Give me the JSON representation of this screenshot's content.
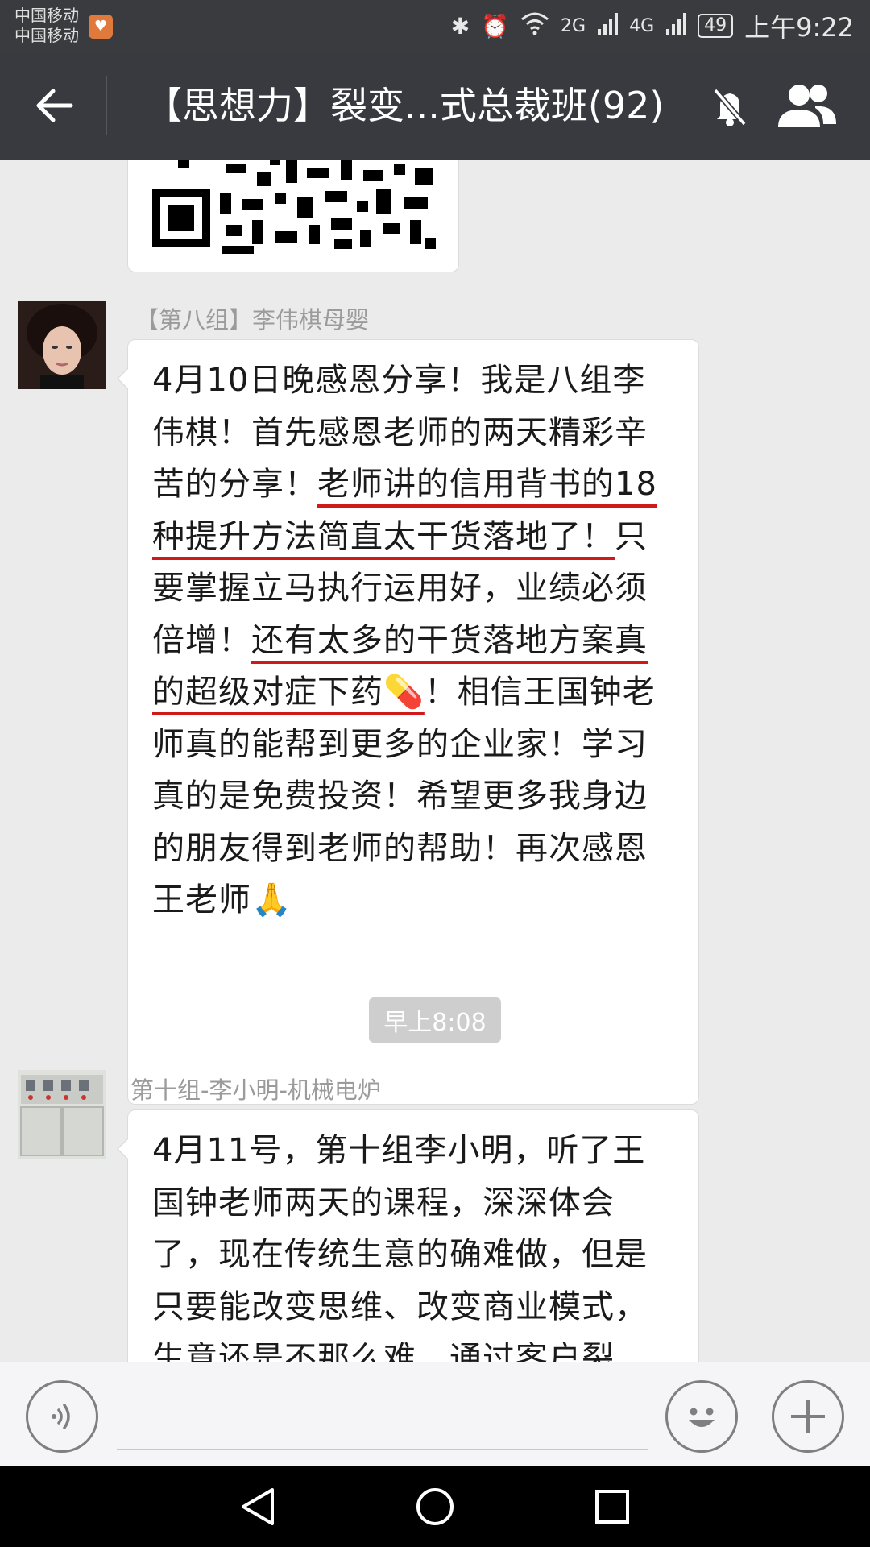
{
  "status_bar": {
    "carrier_1": "中国移动",
    "carrier_2": "中国移动",
    "network_1": "2G",
    "network_2": "4G",
    "battery": "49",
    "time": "上午9:22"
  },
  "header": {
    "title": "【思想力】裂变...式总裁班(92)",
    "icons": [
      "back-arrow-icon",
      "mute-bell-icon",
      "group-members-icon"
    ]
  },
  "messages": [
    {
      "sender": "【第八组】李伟棋母婴",
      "segments": [
        {
          "text": "4月10日晚感恩分享！我是八组李伟棋！首先感恩老师的两天精彩辛苦的分享！",
          "hl": false
        },
        {
          "text": "老师讲的信用背书的18种提升方法简直太干货落地了！",
          "hl": true
        },
        {
          "text": "只要掌握立马执行运用好，业绩必须倍增！",
          "hl": false
        },
        {
          "text": "还有太多的干货落地方案真的超级对症下药💊",
          "hl": true
        },
        {
          "text": "！相信王国钟老师真的能帮到更多的企业家！学习真的是免费投资！希望更多我身边的朋友得到老师的帮助！再次感恩王老师🙏",
          "hl": false
        }
      ]
    },
    {
      "sender": "第十组-李小明-机械电炉",
      "segments": [
        {
          "text": "4月11号，第十组李小明，听了王国钟老师两天的课程，深深体会了，现在传统生意的确难做，但是只要能改变思维、改变商业模式，生意还是不那么难，通过客户裂",
          "hl": false
        }
      ]
    }
  ],
  "timestamp": "早上8:08",
  "input_bar": {
    "icons": [
      "voice-icon",
      "emoji-icon",
      "plus-icon"
    ]
  },
  "nav_bar": {
    "icons": [
      "nav-back-icon",
      "nav-home-icon",
      "nav-recents-icon"
    ]
  },
  "colors": {
    "status_bar": "#3a3b3f",
    "title_bar": "#393a3f",
    "chat_bg": "#ebebeb",
    "underline": "#d01a1a"
  }
}
